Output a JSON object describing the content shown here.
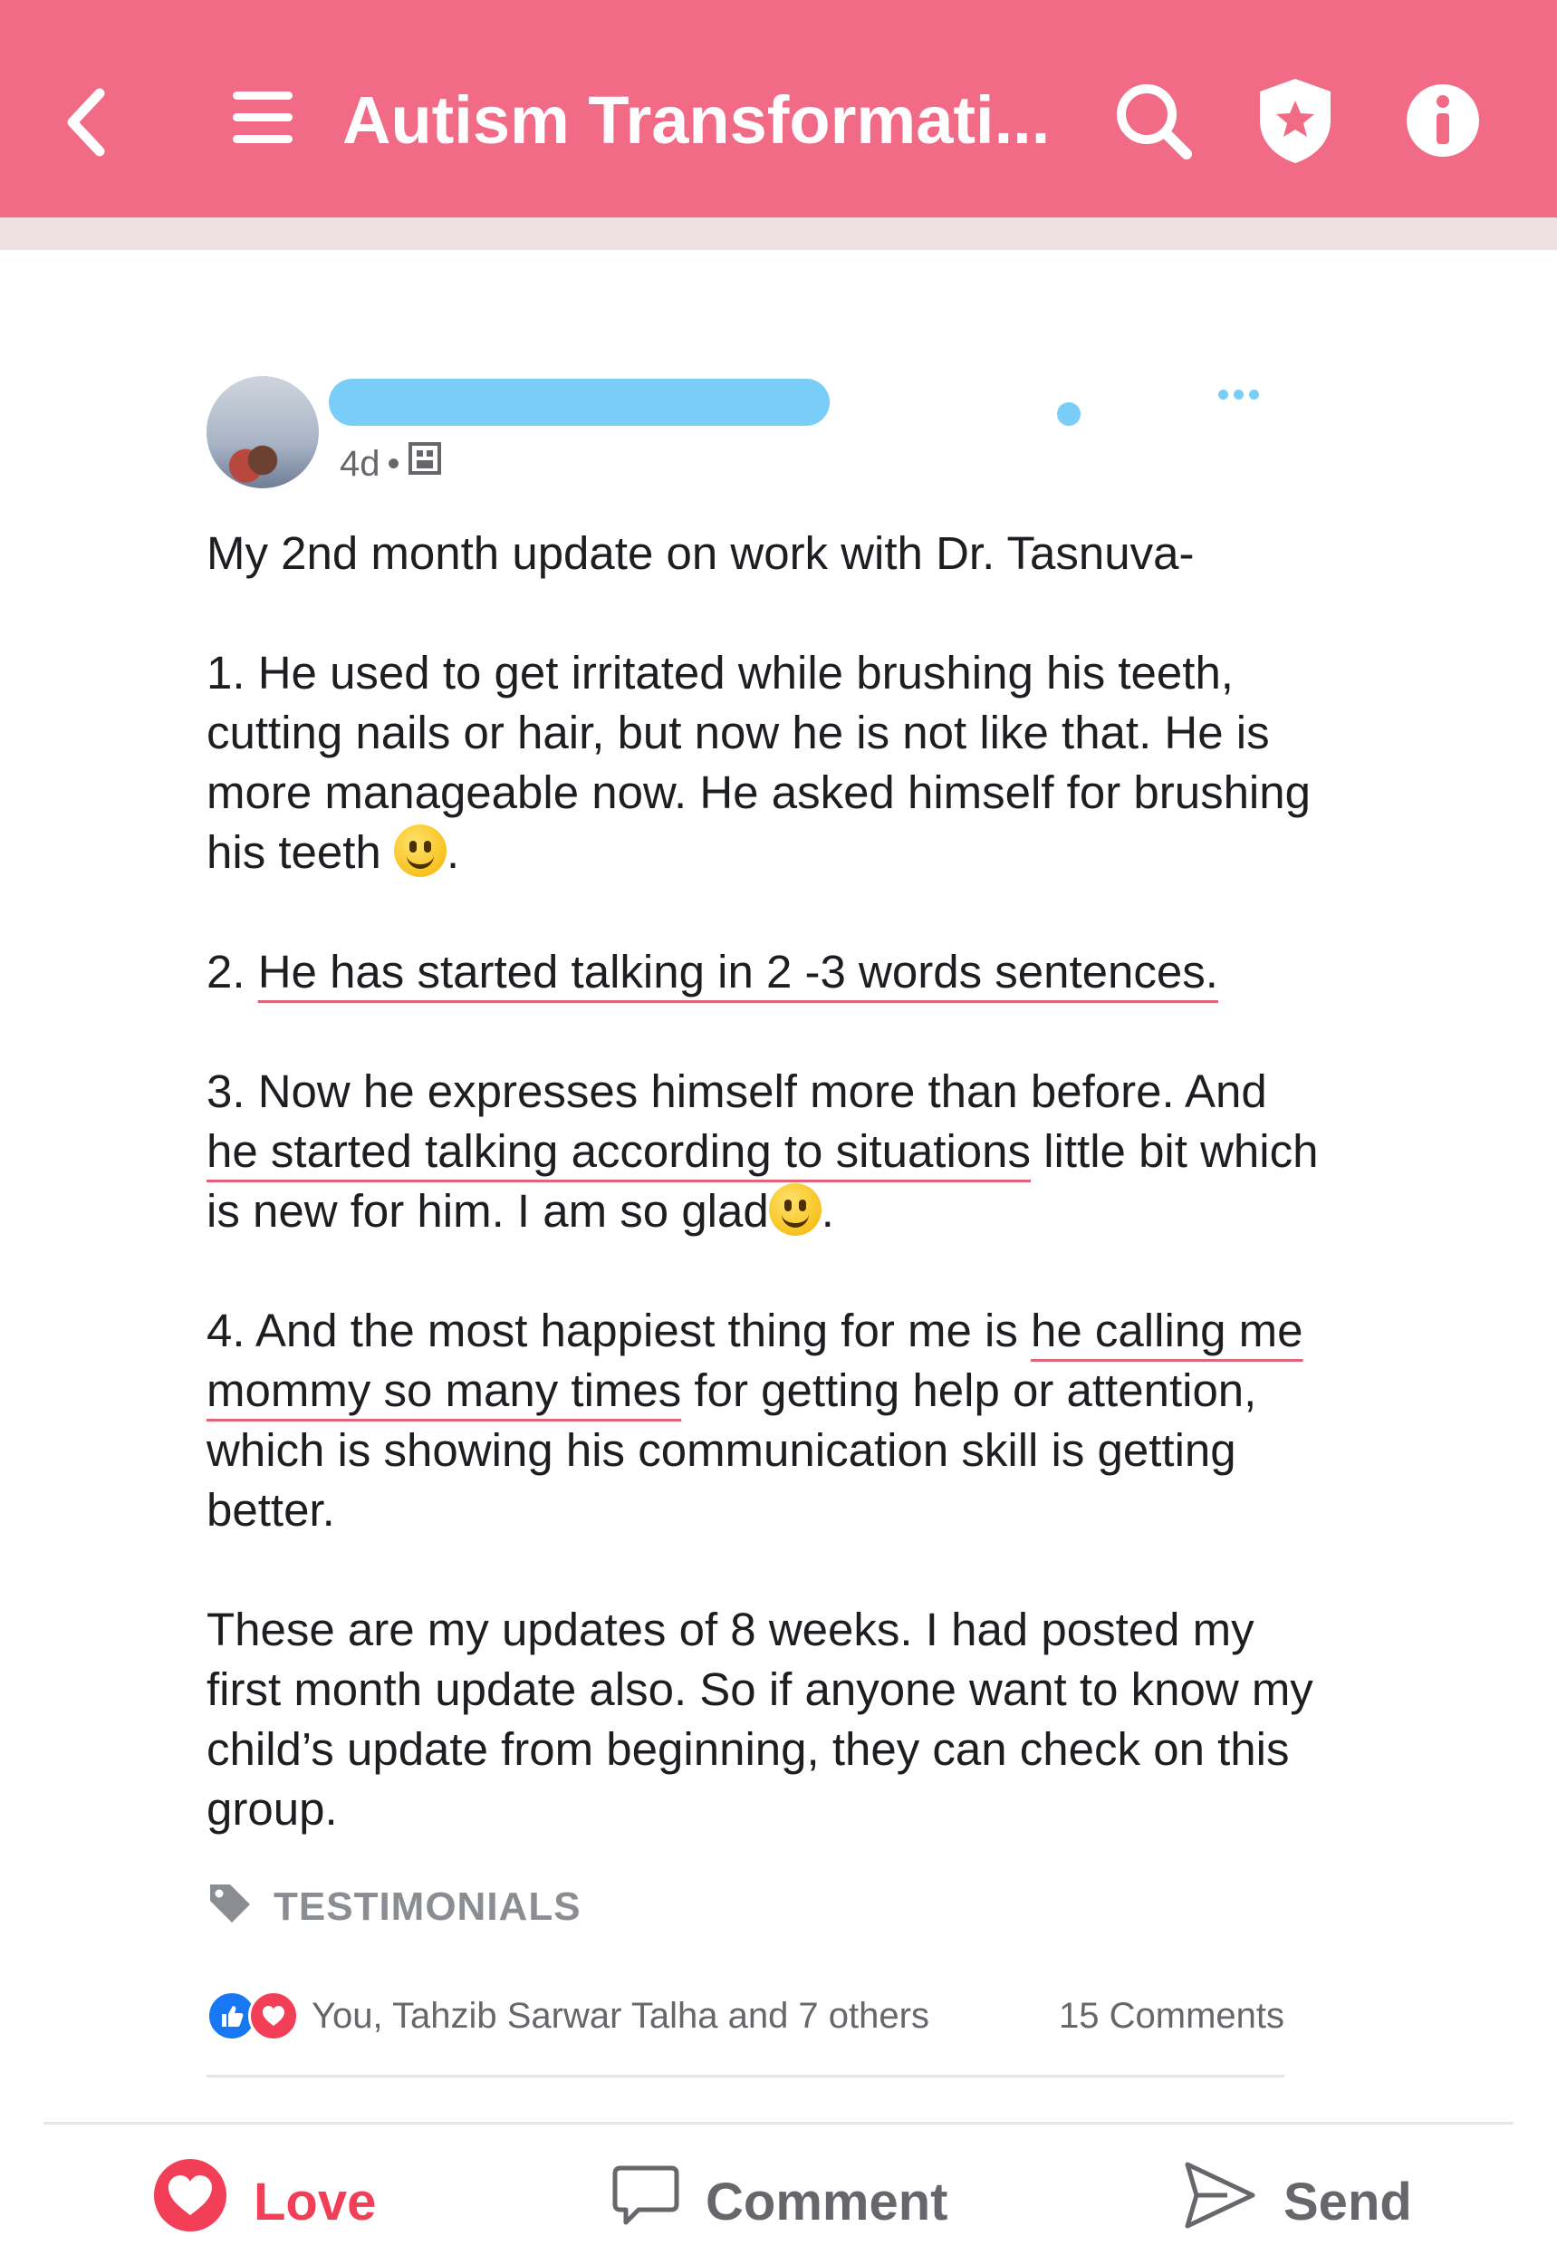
{
  "header": {
    "title": "Autism Transformati...",
    "icons": [
      "back-arrow-icon",
      "menu-icon",
      "search-icon",
      "shield-star-icon",
      "info-icon"
    ],
    "background": "#f16b86"
  },
  "post": {
    "time": "4d",
    "separator": "•",
    "paragraphs": [
      {
        "text": "My 2nd month update on work with Dr. Tasnuva-"
      },
      {
        "p1_a": "1. He used to get irritated while brushing his teeth, cutting nails or hair, but now he is not like that. He is more manageable now. He asked himself for brushing his teeth ",
        "p1_b": "."
      },
      {
        "p2_a": "2. ",
        "p2_u": "He has started talking in 2 -3 words sentences."
      },
      {
        "p3_a": "3. Now he expresses himself more than before. And  ",
        "p3_u": "he started talking according to situations",
        "p3_b": " little bit which is new for him. I am so glad",
        "p3_c": "."
      },
      {
        "p4_a": "4. And the most happiest thing for me is ",
        "p4_u": "he calling me mommy so many times",
        "p4_b": " for getting help or attention, which is showing his communication skill is getting better."
      },
      {
        "text": "These are my updates of 8 weeks. I had posted my first month update also. So if anyone want to know my child’s update from beginning, they can check on this group."
      }
    ],
    "tag": "TESTIMONIALS",
    "reactions_text": "You, Tahzib Sarwar Talha and 7 others",
    "comments_text": "15 Comments"
  },
  "actions": {
    "love": "Love",
    "comment": "Comment",
    "send": "Send"
  },
  "colors": {
    "accent": "#f16b86",
    "love": "#f33e58",
    "like": "#1877f2",
    "redaction": "#79cdf6"
  }
}
